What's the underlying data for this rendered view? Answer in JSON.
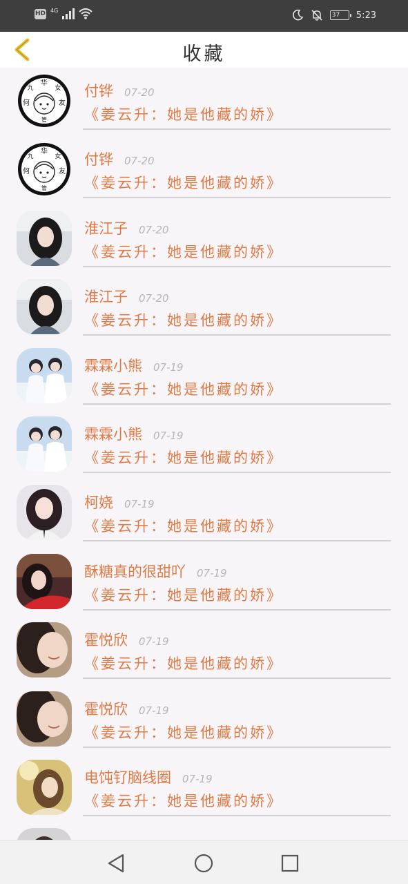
{
  "status_bar": {
    "hd_label": "HD",
    "network_label": "4G",
    "battery_level": "37",
    "time": "5:23",
    "icons": [
      "signal-icon",
      "wifi-icon",
      "moon-icon",
      "bell-off-icon",
      "battery-icon"
    ]
  },
  "header": {
    "title": "收藏",
    "back_icon": "chevron-left-icon",
    "back_color": "#e5c233"
  },
  "list": {
    "items": [
      {
        "name": "付铧",
        "date": "07-20",
        "title": "《姜云升：她是他藏的娇》",
        "avatar": "ring"
      },
      {
        "name": "付铧",
        "date": "07-20",
        "title": "《姜云升：她是他藏的娇》",
        "avatar": "ring"
      },
      {
        "name": "淮江子",
        "date": "07-20",
        "title": "《姜云升：她是他藏的娇》",
        "avatar": "photo-a"
      },
      {
        "name": "淮江子",
        "date": "07-20",
        "title": "《姜云升：她是他藏的娇》",
        "avatar": "photo-a"
      },
      {
        "name": "霖霖小熊",
        "date": "07-19",
        "title": "《姜云升：她是他藏的娇》",
        "avatar": "photo-b"
      },
      {
        "name": "霖霖小熊",
        "date": "07-19",
        "title": "《姜云升：她是他藏的娇》",
        "avatar": "photo-b"
      },
      {
        "name": "柯娆",
        "date": "07-19",
        "title": "《姜云升：她是他藏的娇》",
        "avatar": "photo-c"
      },
      {
        "name": "酥糖真的很甜吖",
        "date": "07-19",
        "title": "《姜云升：她是他藏的娇》",
        "avatar": "photo-d"
      },
      {
        "name": "霍悦欣",
        "date": "07-19",
        "title": "《姜云升：她是他藏的娇》",
        "avatar": "photo-e"
      },
      {
        "name": "霍悦欣",
        "date": "07-19",
        "title": "《姜云升：她是他藏的娇》",
        "avatar": "photo-e"
      },
      {
        "name": "电饨钌脑线圈",
        "date": "07-19",
        "title": "《姜云升：她是他藏的娇》",
        "avatar": "photo-f"
      },
      {
        "name": "",
        "date": "",
        "title": "",
        "avatar": "photo-g"
      }
    ],
    "ring_avatar_text": [
      "九",
      "华",
      "女",
      "何",
      "友",
      "管"
    ]
  },
  "navbar": {
    "icons": [
      "back-triangle-icon",
      "home-circle-icon",
      "recents-square-icon"
    ]
  },
  "colors": {
    "accent": "#e07a45",
    "date": "#b6b6b6",
    "status_bar_bg": "#3e3e3e",
    "page_bg": "#f7f5f8"
  }
}
